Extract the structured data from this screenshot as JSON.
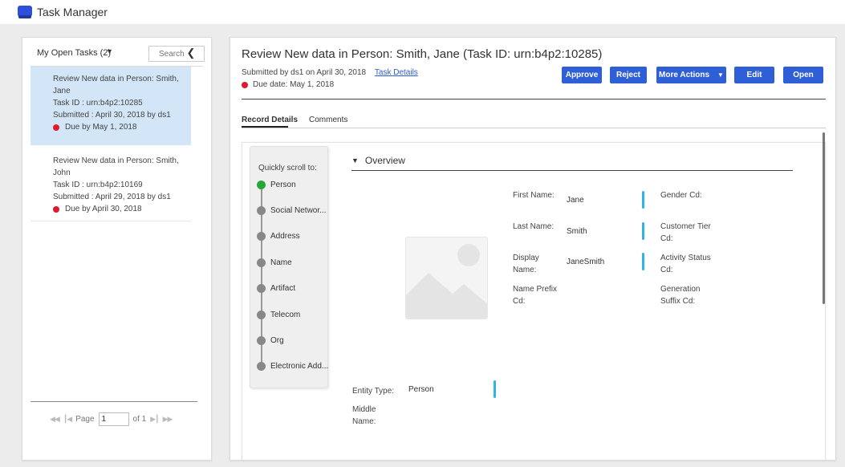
{
  "app": {
    "title": "Task Manager",
    "icon": "app-logo-icon",
    "accent": "#2f5fd6"
  },
  "task_list": {
    "title": "My Open Tasks  (2)",
    "search_placeholder": "Search",
    "items": [
      {
        "line1": "Review New data in Person: Smith,",
        "line2": "Jane",
        "task_id": "Task ID :  urn:b4p2:10285",
        "submitted": "Submitted : April 30, 2018 by ds1",
        "due": "Due by May 1, 2018",
        "selected": true
      },
      {
        "line1": "Review New data in Person: Smith,",
        "line2": "John",
        "task_id": "Task ID :  urn:b4p2:10169",
        "submitted": "Submitted : April 29, 2018 by ds1",
        "due": "Due by April 30, 2018",
        "selected": false
      }
    ],
    "pager": {
      "page_label": "Page",
      "page_value": "1",
      "of_label": "of 1"
    }
  },
  "task": {
    "title": "Review New data in Person: Smith, Jane (Task ID: urn:b4p2:10285)",
    "submitted": "Submitted by ds1 on April 30, 2018",
    "details_link": "Task Details",
    "due": "Due date: May 1, 2018"
  },
  "actions": {
    "approve": "Approve",
    "reject": "Reject",
    "more": "More Actions",
    "edit": "Edit",
    "open": "Open"
  },
  "tabs": {
    "record": "Record Details",
    "comments": "Comments"
  },
  "scroll_nav": {
    "header": "Quickly scroll to:",
    "items": [
      "Person",
      "Social Networ...",
      "Address",
      "Name",
      "Artifact",
      "Telecom",
      "Org",
      "Electronic Add..."
    ]
  },
  "overview": {
    "heading": "Overview",
    "fields": {
      "first_name": {
        "label": "First Name:",
        "value": "Jane"
      },
      "last_name": {
        "label": "Last Name:",
        "value": "Smith"
      },
      "display_name": {
        "label": "Display Name:",
        "value": "JaneSmith"
      },
      "name_prefix": {
        "label": "Name Prefix Cd:",
        "value": ""
      },
      "gender": {
        "label": "Gender Cd:",
        "value": ""
      },
      "customer_tier": {
        "label": "Customer Tier Cd:",
        "value": ""
      },
      "activity_status": {
        "label": "Activity Status Cd:",
        "value": ""
      },
      "generation_suffix": {
        "label": "Generation Suffix Cd:",
        "value": ""
      },
      "entity_type": {
        "label": "Entity Type:",
        "value": "Person"
      },
      "middle_name": {
        "label": "Middle Name:",
        "value": ""
      }
    }
  },
  "colors": {
    "due_dot": "#e0192e",
    "active_section": "#25a83a",
    "selected_row": "#d3e6f7",
    "field_marker": "#2fb3e8"
  }
}
